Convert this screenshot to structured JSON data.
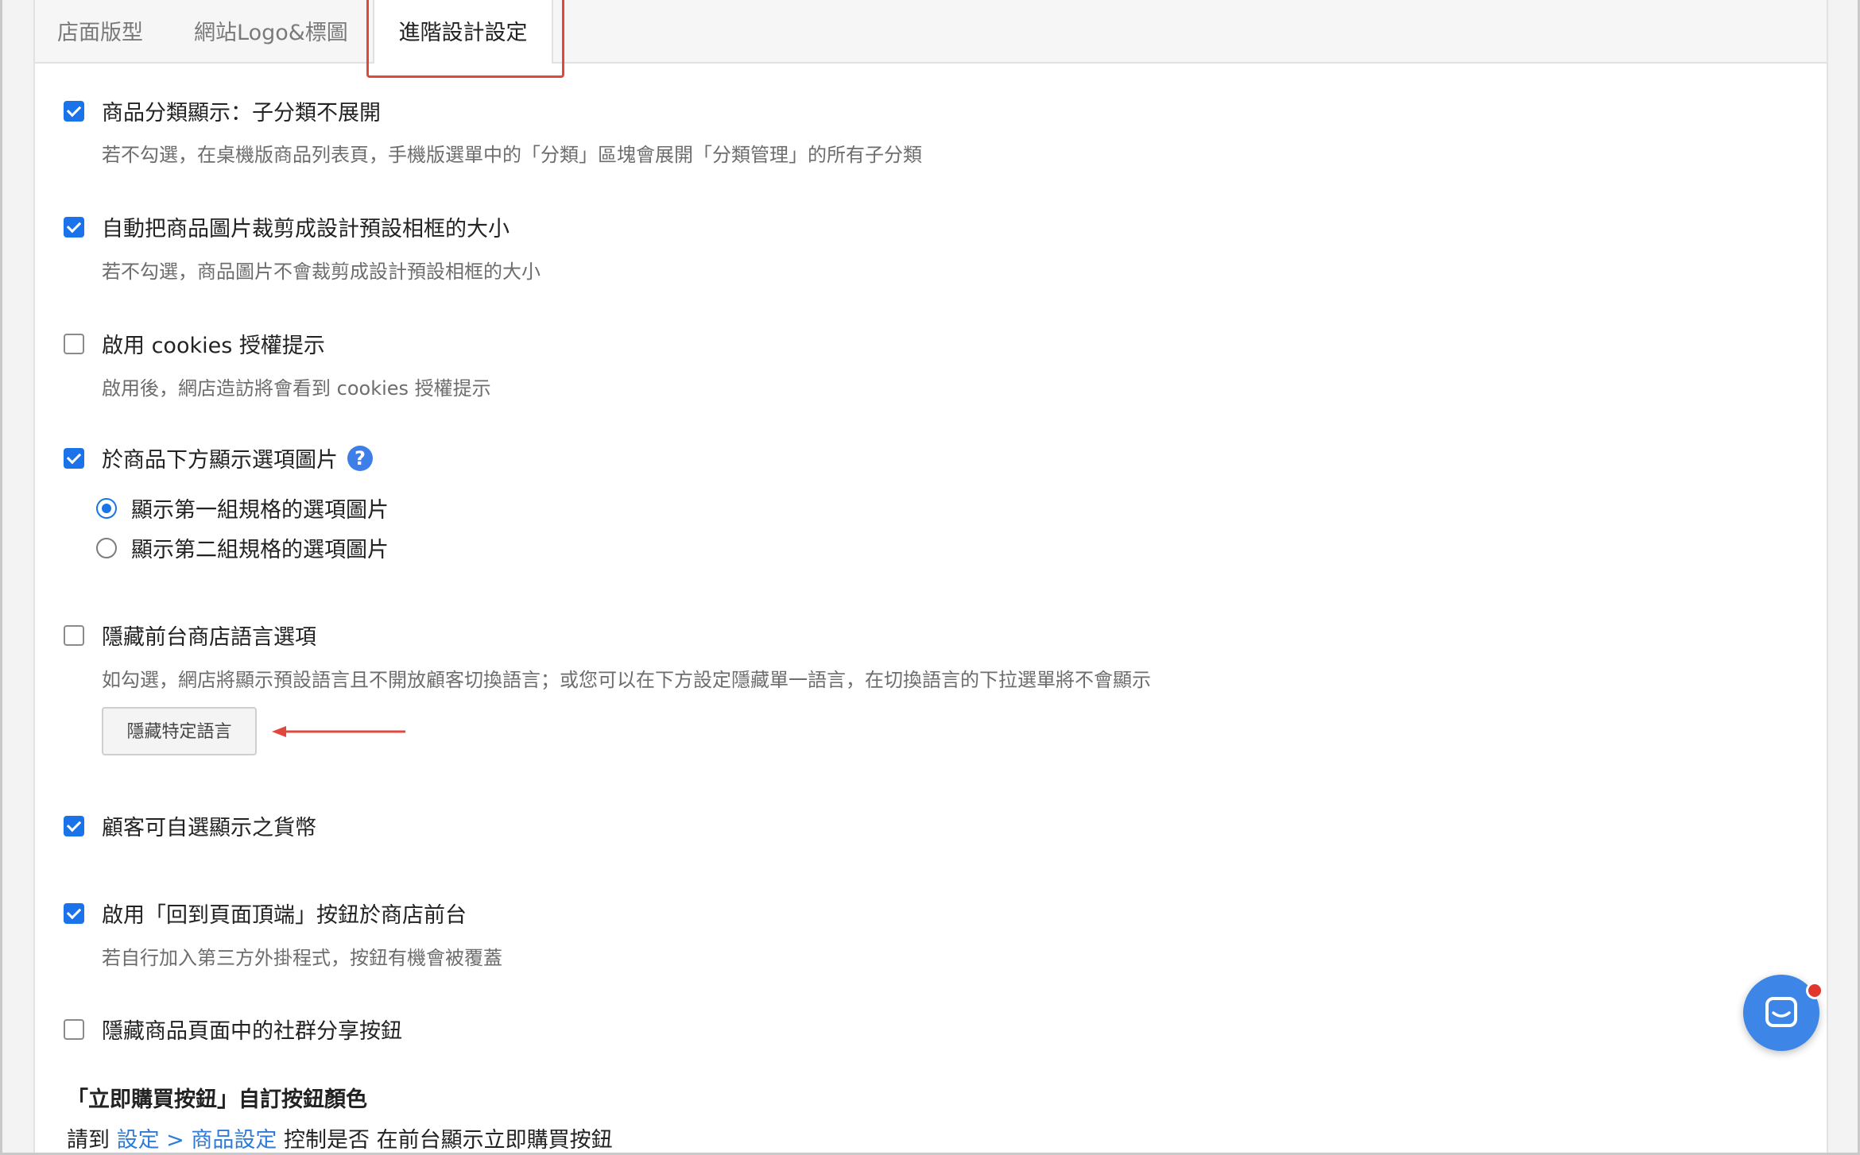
{
  "tabs": [
    {
      "label": "店面版型",
      "active": false
    },
    {
      "label": "網站Logo&標圖",
      "active": false
    },
    {
      "label": "進階設計設定",
      "active": true
    }
  ],
  "settings": {
    "subcategory": {
      "checked": true,
      "label": "商品分類顯示：子分類不展開",
      "help": "若不勾選，在桌機版商品列表頁，手機版選單中的「分類」區塊會展開「分類管理」的所有子分類"
    },
    "crop": {
      "checked": true,
      "label": "自動把商品圖片裁剪成設計預設相框的大小",
      "help": "若不勾選，商品圖片不會裁剪成設計預設相框的大小"
    },
    "cookies": {
      "checked": false,
      "label": "啟用 cookies 授權提示",
      "help": "啟用後，網店造訪將會看到 cookies 授權提示"
    },
    "option_images": {
      "checked": true,
      "label": "於商品下方顯示選項圖片",
      "help_icon": "question-circle-icon",
      "radios": [
        {
          "label": "顯示第一組規格的選項圖片",
          "selected": true
        },
        {
          "label": "顯示第二組規格的選項圖片",
          "selected": false
        }
      ]
    },
    "hide_language": {
      "checked": false,
      "label": "隱藏前台商店語言選項",
      "help": "如勾選，網店將顯示預設語言且不開放顧客切換語言；或您可以在下方設定隱藏單一語言，在切換語言的下拉選單將不會顯示",
      "button_label": "隱藏特定語言"
    },
    "currency": {
      "checked": true,
      "label": "顧客可自選顯示之貨幣"
    },
    "back_to_top": {
      "checked": true,
      "label": "啟用「回到頁面頂端」按鈕於商店前台",
      "help": "若自行加入第三方外掛程式，按鈕有機會被覆蓋"
    },
    "social_share": {
      "checked": false,
      "label": "隱藏商品頁面中的社群分享按鈕"
    }
  },
  "buy_now": {
    "title": "「立即購買按鈕」自訂按鈕顏色",
    "prefix": "請到",
    "link_text": "設定 > 商品設定",
    "suffix": "控制是否 在前台顯示立即購買按鈕"
  },
  "colors": {
    "accent": "#1a73e8",
    "link": "#2f7bd6",
    "annotation": "#e0483d",
    "chat": "#3d85e6"
  },
  "chat_widget": {
    "icon": "chat-bubble-icon",
    "notification": true
  }
}
